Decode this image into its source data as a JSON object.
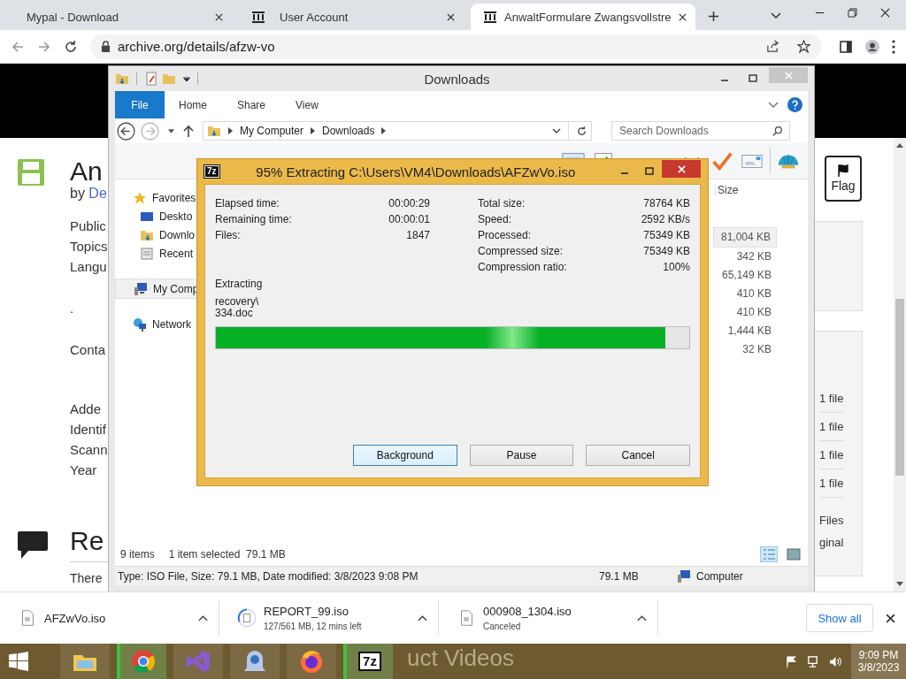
{
  "browser": {
    "tabs": [
      {
        "title": "Mypal - Download",
        "kind": "plain",
        "selected": false
      },
      {
        "title": "User Account",
        "kind": "archive",
        "selected": false
      },
      {
        "title": "AnwaltFormulare Zwangsvollstre",
        "kind": "archive",
        "selected": true
      }
    ],
    "address": "archive.org/details/afzw-vo"
  },
  "page": {
    "title": "An",
    "byline": "by",
    "author": "De",
    "metadata_groups": [
      [
        "Public",
        "Topics",
        "Langu"
      ],
      [
        "."
      ],
      [
        "Conta"
      ],
      [
        "Adde",
        "Identif",
        "Scann",
        "Year"
      ]
    ],
    "reviews_title": "Re",
    "reviews_text": "There",
    "flag_button": "Flag",
    "file_counts": [
      "1 file",
      "1 file",
      "1 file",
      "1 file"
    ],
    "files_link": "Files",
    "original_label": "ginal",
    "footer_text": "uct Videos"
  },
  "explorer": {
    "title": "Downloads",
    "ribbon_tabs": [
      {
        "label": "File",
        "kind": "file_menu"
      },
      {
        "label": "Home",
        "kind": "tab"
      },
      {
        "label": "Share",
        "kind": "tab"
      },
      {
        "label": "View",
        "kind": "tab"
      }
    ],
    "breadcrumbs": [
      "My Computer",
      "Downloads"
    ],
    "search_placeholder": "Search Downloads",
    "nav": [
      {
        "label": "Favorites",
        "kind": "star",
        "selected": false,
        "children": [
          {
            "label": "Deskto",
            "kind": "desktop",
            "selected": false
          },
          {
            "label": "Downlo",
            "kind": "downloads",
            "selected": false
          },
          {
            "label": "Recent",
            "kind": "recent",
            "selected": false
          }
        ]
      },
      {
        "label": "My Comp",
        "kind": "computer",
        "selected": true
      },
      {
        "label": "Network",
        "kind": "network",
        "selected": false
      }
    ],
    "size_column": "Size",
    "sizes": [
      {
        "text": "81,004 KB",
        "selected": true
      },
      {
        "text": "342 KB",
        "selected": false
      },
      {
        "text": "65,149 KB",
        "selected": false
      },
      {
        "text": "410 KB",
        "selected": false
      },
      {
        "text": "410 KB",
        "selected": false
      },
      {
        "text": "1,444 KB",
        "selected": false
      },
      {
        "text": "32 KB",
        "selected": false
      }
    ],
    "item_count": "9 items",
    "selection_info": "1 item selected  79.1 MB",
    "details": "Type: ISO File, Size: 79.1 MB, Date modified: 3/8/2023 9:08 PM",
    "details_size": "79.1 MB",
    "details_location": "Computer"
  },
  "dialog": {
    "logo_label": "7z",
    "title": "95% Extracting C:\\Users\\VM4\\Downloads\\AFZwVo.iso",
    "stats_left": [
      {
        "label": "Elapsed time:",
        "value": "00:00:29"
      },
      {
        "label": "Remaining time:",
        "value": "00:00:01"
      },
      {
        "label": "Files:",
        "value": "1847"
      }
    ],
    "stats_right": [
      {
        "label": "Total size:",
        "value": "78764 KB"
      },
      {
        "label": "Speed:",
        "value": "2592 KB/s"
      },
      {
        "label": "Processed:",
        "value": "75349 KB"
      },
      {
        "label": "Compressed size:",
        "value": "75349 KB"
      },
      {
        "label": "Compression ratio:",
        "value": "100%"
      }
    ],
    "extracting_label": "Extracting",
    "current_file": [
      "recovery\\",
      "334.doc"
    ],
    "progress": {
      "level": 0.95
    },
    "buttons": [
      {
        "label": "Background",
        "focused": true
      },
      {
        "label": "Pause",
        "focused": false
      },
      {
        "label": "Cancel",
        "focused": false
      }
    ]
  },
  "downloads": {
    "items": [
      {
        "name": "AFZwVo.iso",
        "kind": "done"
      },
      {
        "name": "REPORT_99.iso",
        "status": "127/561 MB, 12 mins left",
        "kind": "progress"
      },
      {
        "name": "000908_1304.iso",
        "status": "Canceled",
        "kind": "canceled"
      }
    ],
    "show_all": "Show all"
  },
  "taskbar": {
    "apps": [
      {
        "kind": "explorer",
        "active": false
      },
      {
        "kind": "chrome",
        "active": true
      },
      {
        "kind": "studio",
        "active": false
      },
      {
        "kind": "bell",
        "active": false
      },
      {
        "kind": "firefox",
        "active": false
      },
      {
        "kind": "sevenzip",
        "active": true
      }
    ],
    "sevenzip_label": "7z",
    "time": "9:09 PM",
    "date": "3/8/2023"
  }
}
